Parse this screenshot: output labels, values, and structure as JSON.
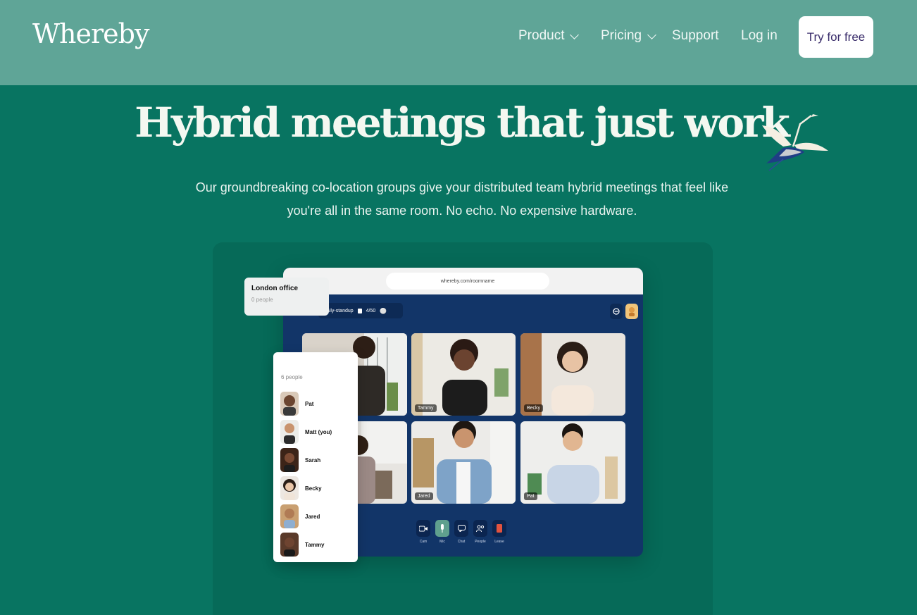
{
  "header": {
    "logo": "Whereby",
    "nav": [
      {
        "label": "Product"
      },
      {
        "label": "Pricing"
      },
      {
        "label": "Support"
      },
      {
        "label": "Log in"
      }
    ],
    "cta": "Try for free"
  },
  "hero": {
    "title": "Hybrid meetings that just work",
    "subtitle": "Our groundbreaking co-location groups give your distributed team hybrid meetings that feel like you're all in the same room. No echo. No expensive hardware."
  },
  "demo": {
    "url": "whereby.com/roomname",
    "room_name": "daily-standup",
    "room_count": "4/50",
    "location_card": {
      "title": "London office",
      "people": "0 people"
    },
    "participants_header": "6 people",
    "participants": [
      {
        "name": "Pat"
      },
      {
        "name": "Matt (you)"
      },
      {
        "name": "Sarah"
      },
      {
        "name": "Becky"
      },
      {
        "name": "Jared"
      },
      {
        "name": "Tammy"
      }
    ],
    "tiles": [
      {
        "label": ""
      },
      {
        "label": "Tammy"
      },
      {
        "label": "Becky"
      },
      {
        "label": ""
      },
      {
        "label": "Jared"
      },
      {
        "label": "Pat"
      }
    ],
    "controls": [
      {
        "label": "Cam",
        "icon": "camera-icon"
      },
      {
        "label": "Mic",
        "icon": "mic-icon"
      },
      {
        "label": "Chat",
        "icon": "chat-icon"
      },
      {
        "label": "People",
        "icon": "people-icon"
      },
      {
        "label": "Leave",
        "icon": "leave-icon"
      }
    ]
  },
  "colors": {
    "background": "#087461",
    "header": "#5fa597",
    "call_background": "#123568"
  }
}
